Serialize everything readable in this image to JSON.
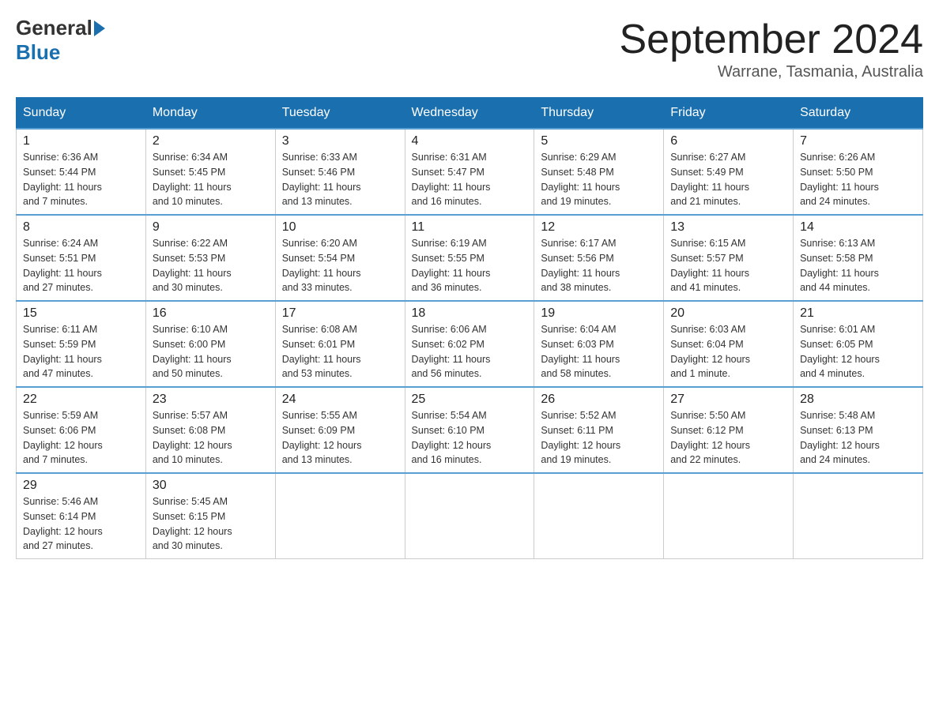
{
  "header": {
    "logo_general": "General",
    "logo_blue": "Blue",
    "month_title": "September 2024",
    "location": "Warrane, Tasmania, Australia"
  },
  "days_of_week": [
    "Sunday",
    "Monday",
    "Tuesday",
    "Wednesday",
    "Thursday",
    "Friday",
    "Saturday"
  ],
  "weeks": [
    [
      {
        "day": "1",
        "sunrise": "6:36 AM",
        "sunset": "5:44 PM",
        "daylight": "11 hours and 7 minutes."
      },
      {
        "day": "2",
        "sunrise": "6:34 AM",
        "sunset": "5:45 PM",
        "daylight": "11 hours and 10 minutes."
      },
      {
        "day": "3",
        "sunrise": "6:33 AM",
        "sunset": "5:46 PM",
        "daylight": "11 hours and 13 minutes."
      },
      {
        "day": "4",
        "sunrise": "6:31 AM",
        "sunset": "5:47 PM",
        "daylight": "11 hours and 16 minutes."
      },
      {
        "day": "5",
        "sunrise": "6:29 AM",
        "sunset": "5:48 PM",
        "daylight": "11 hours and 19 minutes."
      },
      {
        "day": "6",
        "sunrise": "6:27 AM",
        "sunset": "5:49 PM",
        "daylight": "11 hours and 21 minutes."
      },
      {
        "day": "7",
        "sunrise": "6:26 AM",
        "sunset": "5:50 PM",
        "daylight": "11 hours and 24 minutes."
      }
    ],
    [
      {
        "day": "8",
        "sunrise": "6:24 AM",
        "sunset": "5:51 PM",
        "daylight": "11 hours and 27 minutes."
      },
      {
        "day": "9",
        "sunrise": "6:22 AM",
        "sunset": "5:53 PM",
        "daylight": "11 hours and 30 minutes."
      },
      {
        "day": "10",
        "sunrise": "6:20 AM",
        "sunset": "5:54 PM",
        "daylight": "11 hours and 33 minutes."
      },
      {
        "day": "11",
        "sunrise": "6:19 AM",
        "sunset": "5:55 PM",
        "daylight": "11 hours and 36 minutes."
      },
      {
        "day": "12",
        "sunrise": "6:17 AM",
        "sunset": "5:56 PM",
        "daylight": "11 hours and 38 minutes."
      },
      {
        "day": "13",
        "sunrise": "6:15 AM",
        "sunset": "5:57 PM",
        "daylight": "11 hours and 41 minutes."
      },
      {
        "day": "14",
        "sunrise": "6:13 AM",
        "sunset": "5:58 PM",
        "daylight": "11 hours and 44 minutes."
      }
    ],
    [
      {
        "day": "15",
        "sunrise": "6:11 AM",
        "sunset": "5:59 PM",
        "daylight": "11 hours and 47 minutes."
      },
      {
        "day": "16",
        "sunrise": "6:10 AM",
        "sunset": "6:00 PM",
        "daylight": "11 hours and 50 minutes."
      },
      {
        "day": "17",
        "sunrise": "6:08 AM",
        "sunset": "6:01 PM",
        "daylight": "11 hours and 53 minutes."
      },
      {
        "day": "18",
        "sunrise": "6:06 AM",
        "sunset": "6:02 PM",
        "daylight": "11 hours and 56 minutes."
      },
      {
        "day": "19",
        "sunrise": "6:04 AM",
        "sunset": "6:03 PM",
        "daylight": "11 hours and 58 minutes."
      },
      {
        "day": "20",
        "sunrise": "6:03 AM",
        "sunset": "6:04 PM",
        "daylight": "12 hours and 1 minute."
      },
      {
        "day": "21",
        "sunrise": "6:01 AM",
        "sunset": "6:05 PM",
        "daylight": "12 hours and 4 minutes."
      }
    ],
    [
      {
        "day": "22",
        "sunrise": "5:59 AM",
        "sunset": "6:06 PM",
        "daylight": "12 hours and 7 minutes."
      },
      {
        "day": "23",
        "sunrise": "5:57 AM",
        "sunset": "6:08 PM",
        "daylight": "12 hours and 10 minutes."
      },
      {
        "day": "24",
        "sunrise": "5:55 AM",
        "sunset": "6:09 PM",
        "daylight": "12 hours and 13 minutes."
      },
      {
        "day": "25",
        "sunrise": "5:54 AM",
        "sunset": "6:10 PM",
        "daylight": "12 hours and 16 minutes."
      },
      {
        "day": "26",
        "sunrise": "5:52 AM",
        "sunset": "6:11 PM",
        "daylight": "12 hours and 19 minutes."
      },
      {
        "day": "27",
        "sunrise": "5:50 AM",
        "sunset": "6:12 PM",
        "daylight": "12 hours and 22 minutes."
      },
      {
        "day": "28",
        "sunrise": "5:48 AM",
        "sunset": "6:13 PM",
        "daylight": "12 hours and 24 minutes."
      }
    ],
    [
      {
        "day": "29",
        "sunrise": "5:46 AM",
        "sunset": "6:14 PM",
        "daylight": "12 hours and 27 minutes."
      },
      {
        "day": "30",
        "sunrise": "5:45 AM",
        "sunset": "6:15 PM",
        "daylight": "12 hours and 30 minutes."
      },
      null,
      null,
      null,
      null,
      null
    ]
  ],
  "labels": {
    "sunrise": "Sunrise:",
    "sunset": "Sunset:",
    "daylight": "Daylight:"
  }
}
